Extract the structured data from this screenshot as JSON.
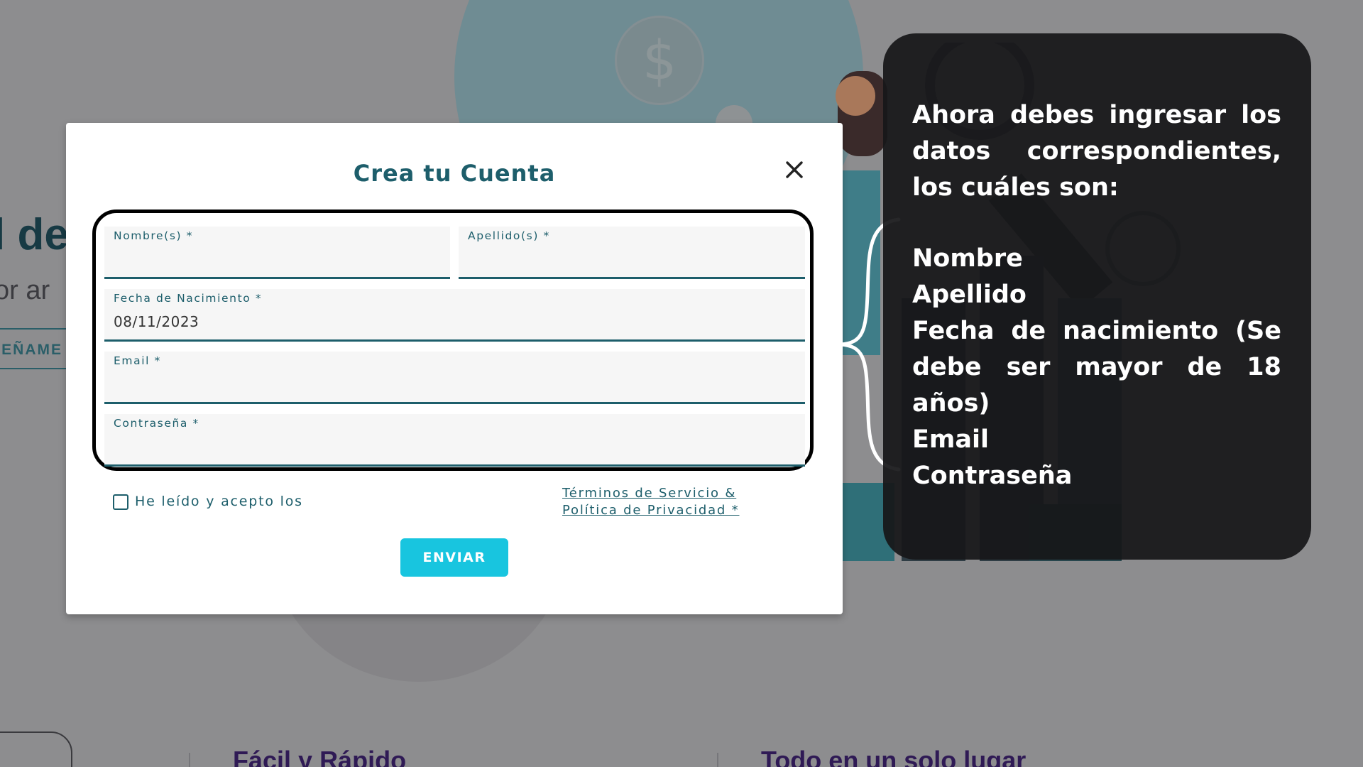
{
  "background": {
    "hero_title": "l de",
    "hero_subtitle": "or ar",
    "hero_button": "EÑAME",
    "features": [
      "Fácil y Rápido",
      "Todo en un solo lugar"
    ],
    "coin_symbol": "$"
  },
  "modal": {
    "title": "Crea tu Cuenta",
    "close_symbol": "×",
    "fields": {
      "nombre": {
        "label": "Nombre(s) *",
        "value": ""
      },
      "apellido": {
        "label": "Apellido(s) *",
        "value": ""
      },
      "fecha": {
        "label": "Fecha de Nacimiento *",
        "value": "08/11/2023"
      },
      "email": {
        "label": "Email *",
        "value": ""
      },
      "password": {
        "label": "Contraseña *",
        "value": ""
      }
    },
    "accept_text": "He leído y acepto los",
    "accept_checked": false,
    "terms_link_line1": "Términos de Servicio &",
    "terms_link_line2": "Política de Privacidad *",
    "submit_label": "ENVIAR"
  },
  "tutorial": {
    "intro": "Ahora debes ingresar los datos correspondientes, los cuáles son:",
    "items": [
      "Nombre",
      "Apellido",
      "Fecha de nacimiento (Se debe ser mayor de 18 años)",
      "Email",
      "Contraseña"
    ]
  },
  "colors": {
    "accent": "#1d5e6b",
    "button": "#18c5df",
    "overlay": "#171719"
  }
}
